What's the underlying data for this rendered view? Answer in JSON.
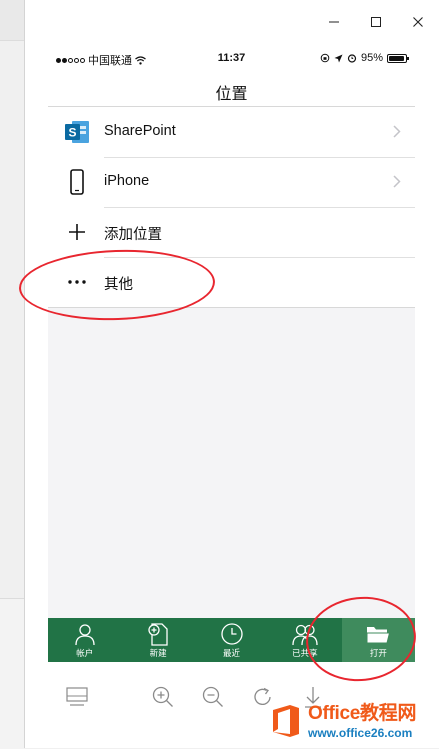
{
  "status_bar": {
    "carrier": "中国联通",
    "time": "11:37",
    "battery": "95%",
    "battery_level": 0.95,
    "signal_dots_filled": 2,
    "signal_dots_total": 5
  },
  "nav": {
    "title": "位置"
  },
  "locations": [
    {
      "label": "SharePoint",
      "icon": "sharepoint-icon",
      "has_chevron": true
    },
    {
      "label": "iPhone",
      "icon": "phone-icon",
      "has_chevron": true
    },
    {
      "label": "添加位置",
      "icon": "plus-icon",
      "has_chevron": false
    },
    {
      "label": "其他",
      "icon": "more-icon",
      "has_chevron": false
    }
  ],
  "tabs": [
    {
      "label": "帐户",
      "icon": "account-icon",
      "active": false
    },
    {
      "label": "新建",
      "icon": "new-document-icon",
      "active": false
    },
    {
      "label": "最近",
      "icon": "clock-icon",
      "active": false
    },
    {
      "label": "已共享",
      "icon": "shared-users-icon",
      "active": false
    },
    {
      "label": "打开",
      "icon": "folder-icon",
      "active": true
    }
  ],
  "toolbar": [
    "device-frame-icon",
    "zoom-in-icon",
    "zoom-out-icon",
    "rotate-icon",
    "download-icon"
  ],
  "colors": {
    "accent": "#217346",
    "active_tab": "#3f8b5d",
    "annotation": "#e8262f",
    "sharepoint": "#0b6aa2",
    "watermark_orange": "#f05a1a",
    "watermark_blue": "#1a7fc0"
  },
  "watermark": {
    "title": "Office教程网",
    "url": "www.office26.com"
  }
}
